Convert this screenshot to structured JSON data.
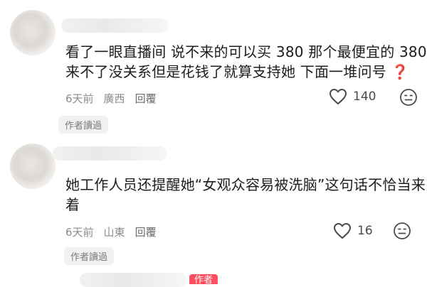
{
  "comments": [
    {
      "text_line1": "看了一眼直播间 说不来的可以买 380 那个最便宜的 380",
      "text_line2": "来不了没关系但是花钱了就算支持她 下面一堆问号",
      "question_mark": "❓",
      "time": "6天前",
      "location": "廣西",
      "reply_label": "回覆",
      "like_count": "140",
      "badge": "作者讀過"
    },
    {
      "text_line1": "她工作人员还提醒她“女观众容易被洗脑”这句话不恰当来",
      "text_line2": "着",
      "time": "6天前",
      "location": "山東",
      "reply_label": "回覆",
      "like_count": "16",
      "badge": "作者讀過"
    }
  ],
  "third_comment": {
    "author_tag": "作者"
  },
  "icons": {
    "like": "heart-outline-icon",
    "reaction": "emoji-face-icon"
  }
}
